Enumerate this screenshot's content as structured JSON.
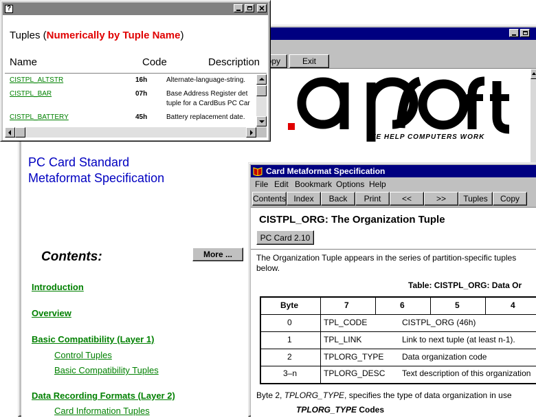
{
  "back_window": {
    "toolbar": {
      "copy": "Copy",
      "exit": "Exit"
    },
    "logo": {
      "text": ".apsoft",
      "tagline": "WE HELP COMPUTERS WORK"
    },
    "heading_line1": "PC Card Standard",
    "heading_line2": "Metaformat Specification",
    "more_button": "More ...",
    "contents_title": "Contents:",
    "toc": [
      {
        "label": "Introduction",
        "level": 1
      },
      {
        "label": "Overview",
        "level": 1
      },
      {
        "label": "Basic Compatibility (Layer 1)",
        "level": 1
      },
      {
        "label": "Control Tuples",
        "level": 2
      },
      {
        "label": "Basic Compatibility Tuples",
        "level": 2
      },
      {
        "label": "Data Recording Formats (Layer 2)",
        "level": 1
      },
      {
        "label": "Card Information Tuples",
        "level": 2
      }
    ]
  },
  "tuples_popup": {
    "system_icon": "?",
    "title_black": "Tuples (",
    "title_red": "Numerically by Tuple Name",
    "title_close": ")",
    "col_name": "Name",
    "col_code": "Code",
    "col_desc": "Description",
    "rows": [
      {
        "name": "CISTPL_ALTSTR",
        "code": "16h",
        "desc": "Alternate-language-string."
      },
      {
        "name": "CISTPL_BAR",
        "code": "07h",
        "desc": "Base Address Register det",
        "desc2": "tuple for a CardBus PC Car"
      },
      {
        "name": "CISTPL_BATTERY",
        "code": "45h",
        "desc": "Battery replacement date."
      }
    ]
  },
  "spec_window": {
    "title": "Card Metaformat Specification",
    "menu": [
      "File",
      "Edit",
      "Bookmark",
      "Options",
      "Help"
    ],
    "toolbar": [
      "Contents",
      "Index",
      "Back",
      "Print",
      "<<",
      ">>",
      "Tuples",
      "Copy"
    ],
    "heading": "CISTPL_ORG: The Organization Tuple",
    "version_button": "PC Card 2.10",
    "intro_line1": "The Organization Tuple appears in the series of partition-specific tuples",
    "intro_line2": "below.",
    "table_caption": "Table: CISTPL_ORG: Data Or",
    "table_header": [
      "Byte",
      "7",
      "6",
      "5",
      "4"
    ],
    "table_rows": [
      {
        "byte": "0",
        "field": "TPL_CODE",
        "desc": "CISTPL_ORG (46h)"
      },
      {
        "byte": "1",
        "field": "TPL_LINK",
        "desc": "Link to next tuple (at least n-1)."
      },
      {
        "byte": "2",
        "field": "TPLORG_TYPE",
        "desc": "Data organization code"
      },
      {
        "byte": "3–n",
        "field": "TPLORG_DESC",
        "desc": "Text description of this organization"
      }
    ],
    "byte2_prefix": "Byte 2, ",
    "byte2_italic": "TPLORG_TYPE",
    "byte2_suffix": ", specifies the type of data organization in use",
    "codes_italic": "TPLORG_TYPE",
    "codes_rest": " Codes"
  }
}
